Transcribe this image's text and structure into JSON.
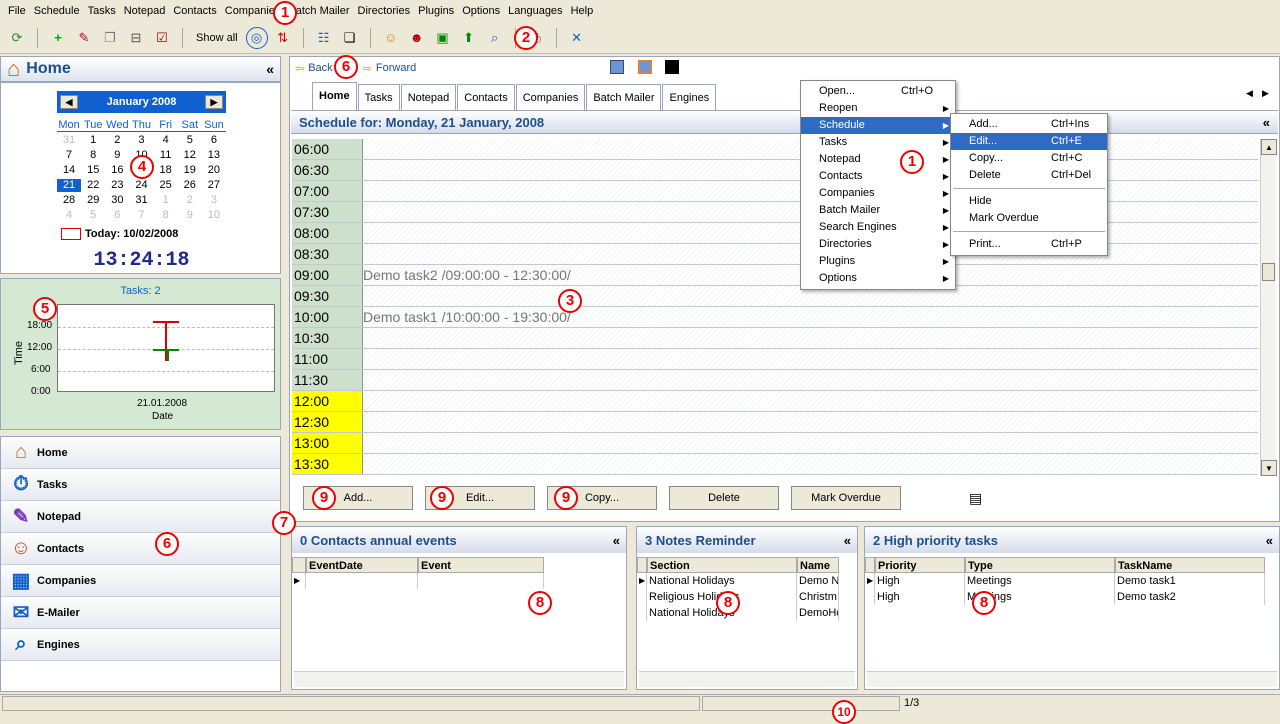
{
  "menu": [
    "File",
    "Schedule",
    "Tasks",
    "Notepad",
    "Contacts",
    "Companies",
    "Batch Mailer",
    "Directories",
    "Plugins",
    "Options",
    "Languages",
    "Help"
  ],
  "toolbar": {
    "show_all": "Show all"
  },
  "left": {
    "title": "Home",
    "collapse": "«",
    "calendar": {
      "month": "January 2008",
      "dow": [
        "Mon",
        "Tue",
        "Wed",
        "Thu",
        "Fri",
        "Sat",
        "Sun"
      ],
      "days": [
        "31",
        "1",
        "2",
        "3",
        "4",
        "5",
        "6",
        "7",
        "8",
        "9",
        "10",
        "11",
        "12",
        "13",
        "14",
        "15",
        "16",
        "17",
        "18",
        "19",
        "20",
        "21",
        "22",
        "23",
        "24",
        "25",
        "26",
        "27",
        "28",
        "29",
        "30",
        "31",
        "1",
        "2",
        "3",
        "4",
        "5",
        "6",
        "7",
        "8",
        "9",
        "10"
      ],
      "today": "Today: 10/02/2008",
      "clock": "13:24:18"
    },
    "minichart": {
      "title": "Tasks: 2",
      "ylabel": "Time",
      "xlabel": "Date",
      "yticks": [
        "18:00",
        "12:00",
        "6:00",
        "0:00"
      ],
      "xtick": "21.01.2008"
    },
    "nav": [
      "Home",
      "Tasks",
      "Notepad",
      "Contacts",
      "Companies",
      "E-Mailer",
      "Engines"
    ]
  },
  "nav": {
    "back": "Back",
    "forward": "Forward"
  },
  "tabs": [
    "Home",
    "Tasks",
    "Notepad",
    "Contacts",
    "Companies",
    "Batch Mailer",
    "Engines"
  ],
  "schedule": {
    "header": "Schedule for: Monday, 21 January, 2008",
    "slots": [
      {
        "time": "06:00",
        "text": "",
        "yellow": false
      },
      {
        "time": "06:30",
        "text": "",
        "yellow": false
      },
      {
        "time": "07:00",
        "text": "",
        "yellow": false
      },
      {
        "time": "07:30",
        "text": "",
        "yellow": false
      },
      {
        "time": "08:00",
        "text": "",
        "yellow": false
      },
      {
        "time": "08:30",
        "text": "",
        "yellow": false
      },
      {
        "time": "09:00",
        "text": "Demo task2 /09:00:00 - 12:30:00/",
        "yellow": false
      },
      {
        "time": "09:30",
        "text": "",
        "yellow": false
      },
      {
        "time": "10:00",
        "text": "Demo task1 /10:00:00 - 19:30:00/",
        "yellow": false
      },
      {
        "time": "10:30",
        "text": "",
        "yellow": false
      },
      {
        "time": "11:00",
        "text": "",
        "yellow": false
      },
      {
        "time": "11:30",
        "text": "",
        "yellow": false
      },
      {
        "time": "12:00",
        "text": "",
        "yellow": true
      },
      {
        "time": "12:30",
        "text": "",
        "yellow": true
      },
      {
        "time": "13:00",
        "text": "",
        "yellow": true
      },
      {
        "time": "13:30",
        "text": "",
        "yellow": true
      }
    ],
    "actions": [
      "Add...",
      "Edit...",
      "Copy...",
      "Delete",
      "Mark Overdue"
    ]
  },
  "panels": {
    "contacts": {
      "title": "0 Contacts annual events",
      "cols": [
        "EventDate",
        "Event"
      ],
      "rows": []
    },
    "notes": {
      "title": "3 Notes Reminder",
      "cols": [
        "Section",
        "Name"
      ],
      "rows": [
        [
          "National Holidays",
          "Demo N"
        ],
        [
          "Religious Holidays",
          "Christm"
        ],
        [
          "National Holidays",
          "DemoHo"
        ]
      ]
    },
    "tasks": {
      "title": "2 High priority tasks",
      "cols": [
        "Priority",
        "Type",
        "TaskName"
      ],
      "rows": [
        [
          "High",
          "Meetings",
          "Demo task1"
        ],
        [
          "High",
          "Meetings",
          "Demo task2"
        ]
      ]
    }
  },
  "context_menu": [
    {
      "label": "Open...",
      "shortcut": "Ctrl+O",
      "sub": false
    },
    {
      "label": "Reopen",
      "shortcut": "",
      "sub": true
    },
    {
      "label": "Schedule",
      "shortcut": "",
      "sub": true,
      "hl": true
    },
    {
      "label": "Tasks",
      "shortcut": "",
      "sub": true
    },
    {
      "label": "Notepad",
      "shortcut": "",
      "sub": true
    },
    {
      "label": "Contacts",
      "shortcut": "",
      "sub": true
    },
    {
      "label": "Companies",
      "shortcut": "",
      "sub": true
    },
    {
      "label": "Batch Mailer",
      "shortcut": "",
      "sub": true
    },
    {
      "label": "Search Engines",
      "shortcut": "",
      "sub": true
    },
    {
      "label": "Directories",
      "shortcut": "",
      "sub": true
    },
    {
      "label": "Plugins",
      "shortcut": "",
      "sub": true
    },
    {
      "label": "Options",
      "shortcut": "",
      "sub": true
    }
  ],
  "submenu": [
    {
      "label": "Add...",
      "shortcut": "Ctrl+Ins"
    },
    {
      "label": "Edit...",
      "shortcut": "Ctrl+E",
      "hl": true
    },
    {
      "label": "Copy...",
      "shortcut": "Ctrl+C"
    },
    {
      "label": "Delete",
      "shortcut": "Ctrl+Del"
    },
    {
      "sep": true
    },
    {
      "label": "Hide",
      "shortcut": ""
    },
    {
      "label": "Mark Overdue",
      "shortcut": ""
    },
    {
      "sep": true
    },
    {
      "label": "Print...",
      "shortcut": "Ctrl+P"
    }
  ],
  "status": {
    "page": "1/3"
  },
  "markers": [
    "1",
    "2",
    "3",
    "4",
    "5",
    "6",
    "6",
    "7",
    "8",
    "8",
    "8",
    "9",
    "9",
    "9",
    "10",
    "1"
  ]
}
